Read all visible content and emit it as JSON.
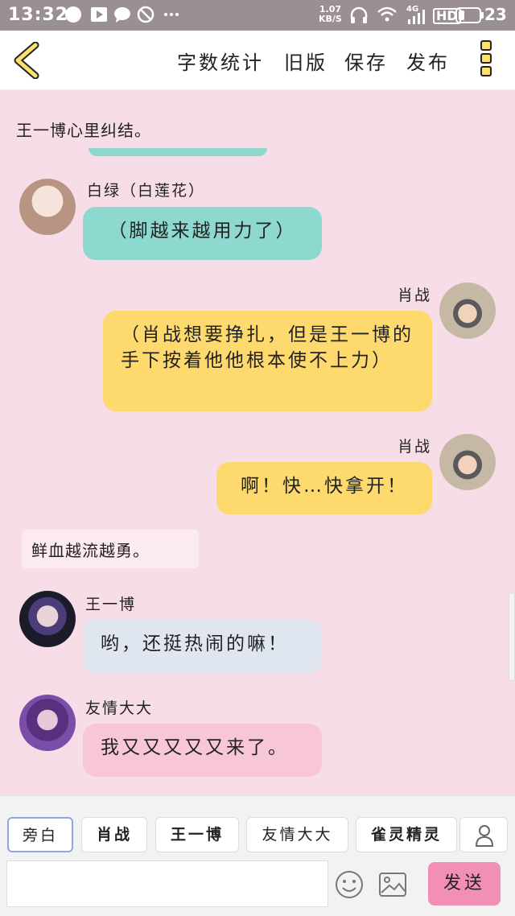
{
  "status_bar": {
    "time": "13:32",
    "speed_value": "1.07",
    "speed_unit": "KB/S",
    "network": "4G",
    "signal_label": "HD",
    "battery": "23"
  },
  "toolbar": {
    "word_count": "字数统计",
    "old_version": "旧版",
    "save": "保存",
    "publish": "发布"
  },
  "chat": {
    "narration_1": "王一博心里纠结。",
    "messages": [
      {
        "sender": "白绿（白莲花）",
        "text": "（脚越来越用力了）",
        "side": "left",
        "color": "#8dd9d0"
      },
      {
        "sender": "肖战",
        "text": "（肖战想要挣扎，但是王一博的手下按着他他根本使不上力）",
        "side": "right",
        "color": "#fed96e"
      },
      {
        "sender": "肖战",
        "text": "啊！快…快拿开！",
        "side": "right",
        "color": "#fed96e"
      },
      {
        "sender": "王一博",
        "text": "哟，还挺热闹的嘛！",
        "side": "left",
        "color": "#dfe6ef"
      },
      {
        "sender": "友情大大",
        "text": "我又又又又又来了。",
        "side": "left",
        "color": "#f8c7d6"
      }
    ],
    "narration_2": "鲜血越流越勇。"
  },
  "roles": [
    "旁白",
    "肖战",
    "王一博",
    "友情大大",
    "雀灵精灵"
  ],
  "input": {
    "value": "",
    "placeholder": ""
  },
  "send_label": "发送",
  "colors": {
    "background": "#f7dde7",
    "send": "#f28fb6",
    "accent_yellow": "#fce26a"
  }
}
